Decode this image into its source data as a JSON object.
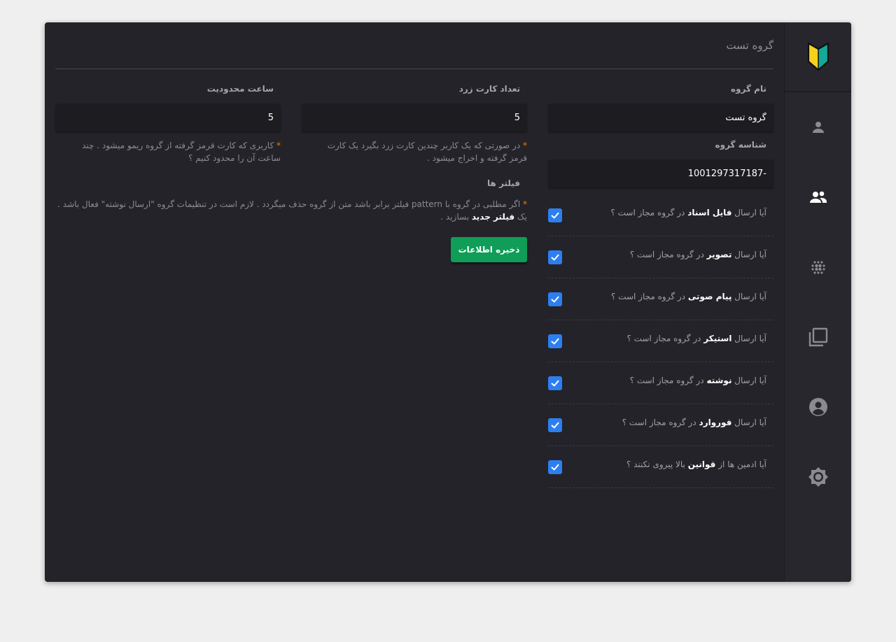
{
  "page": {
    "title": "گروه تست"
  },
  "fields": {
    "group_name_label": "نام گروه",
    "group_name_value": "گروه تست",
    "yellow_card_label": "تعداد کارت زرد",
    "yellow_card_value": "5",
    "restrict_hours_label": "ساعت محدودیت",
    "restrict_hours_value": "5",
    "group_id_label": "شناسه گروه",
    "group_id_value": "-1001297317187",
    "yellow_card_help": "در صورتی که یک کاربر چندین کارت زرد بگیرد یک کارت قرمز گرفته و اخراج میشود .",
    "restrict_hours_help": "کاربری که کارت قرمز گرفته از گروه ریمو میشود . چند ساعت آن را محدود کنیم ؟"
  },
  "filters": {
    "title": "فیلتر ها",
    "help_part1": "اگر مطلبی در گروه با pattern فیلتر برابر باشد متن از گروه حذف میگردد . لازم است در تنظیمات گروه \"ارسال نوشته\" فعال باشد . یک",
    "help_bold": "فیلتر جدید",
    "help_part2": "بسازید ."
  },
  "permissions": [
    {
      "prefix": "آیا ارسال",
      "bold": "فایل اسناد",
      "suffix": "در گروه مجاز است ؟",
      "checked": true
    },
    {
      "prefix": "آیا ارسال",
      "bold": "تصویر",
      "suffix": "در گروه مجاز است ؟",
      "checked": true
    },
    {
      "prefix": "آیا ارسال",
      "bold": "پیام صوتی",
      "suffix": "در گروه مجاز است ؟",
      "checked": true
    },
    {
      "prefix": "آیا ارسال",
      "bold": "استیکر",
      "suffix": "در گروه مجاز است ؟",
      "checked": true
    },
    {
      "prefix": "آیا ارسال",
      "bold": "نوشته",
      "suffix": "در گروه مجاز است ؟",
      "checked": true
    },
    {
      "prefix": "آیا ارسال",
      "bold": "فوروارد",
      "suffix": "در گروه مجاز است ؟",
      "checked": true
    },
    {
      "prefix": "آیا ادمین ها از",
      "bold": "قوانین",
      "suffix": "بالا پیروی نکنند ؟",
      "checked": true
    }
  ],
  "actions": {
    "save_label": "ذخیره اطلاعات"
  },
  "sidebar": {
    "items": [
      {
        "icon": "person-icon",
        "active": false
      },
      {
        "icon": "group-icon",
        "active": true
      },
      {
        "icon": "dots-grid-icon",
        "active": false
      },
      {
        "icon": "library-icon",
        "active": false
      },
      {
        "icon": "account-circle-icon",
        "active": false
      },
      {
        "icon": "brightness-icon",
        "active": false
      }
    ]
  },
  "colors": {
    "background": "#232329",
    "sidebar": "#27272d",
    "accent_blue": "#2d7ff0",
    "save_green": "#0f9d58",
    "asterisk": "#f57c00"
  }
}
